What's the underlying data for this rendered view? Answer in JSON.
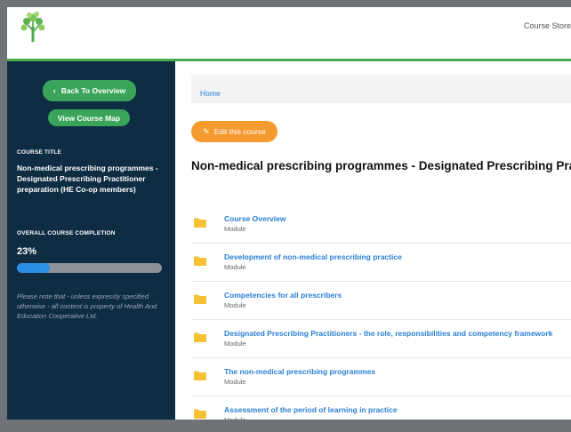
{
  "header": {
    "link": "Course Store"
  },
  "sidebar": {
    "back_label": "Back To Overview",
    "map_label": "View Course Map",
    "course_title_label": "COURSE TITLE",
    "course_title": "Non-medical prescribing programmes - Designated Prescribing Practitioner preparation (HE Co-op members)",
    "completion_label": "OVERALL COURSE COMPLETION",
    "completion_text": "23%",
    "completion_value": 23,
    "note": "Please note that - unless expressly specified otherwise - all content is property of Health And Education Cooperative Ltd."
  },
  "main": {
    "breadcrumb": "Home",
    "edit_label": "Edit this course",
    "title": "Non-medical prescribing programmes - Designated Prescribing Practitioner preparation (HE Co-op members)",
    "modules": [
      {
        "title": "Course Overview",
        "type": "Module"
      },
      {
        "title": "Development of non-medical prescribing practice",
        "type": "Module"
      },
      {
        "title": "Competencies for all prescribers",
        "type": "Module"
      },
      {
        "title": "Designated Prescribing Practitioners - the role, responsibilities and competency framework",
        "type": "Module"
      },
      {
        "title": "The non-medical prescribing programmes",
        "type": "Module"
      },
      {
        "title": "Assessment of the period of learning in practice",
        "type": "Module"
      }
    ]
  },
  "colors": {
    "sidebar_bg": "#0e2d43",
    "accent_green": "#3aa55a",
    "edit_orange": "#f59a2f",
    "link_blue": "#2a7fd4",
    "progress_blue": "#2b8fe5",
    "folder_yellow": "#f5c233"
  }
}
